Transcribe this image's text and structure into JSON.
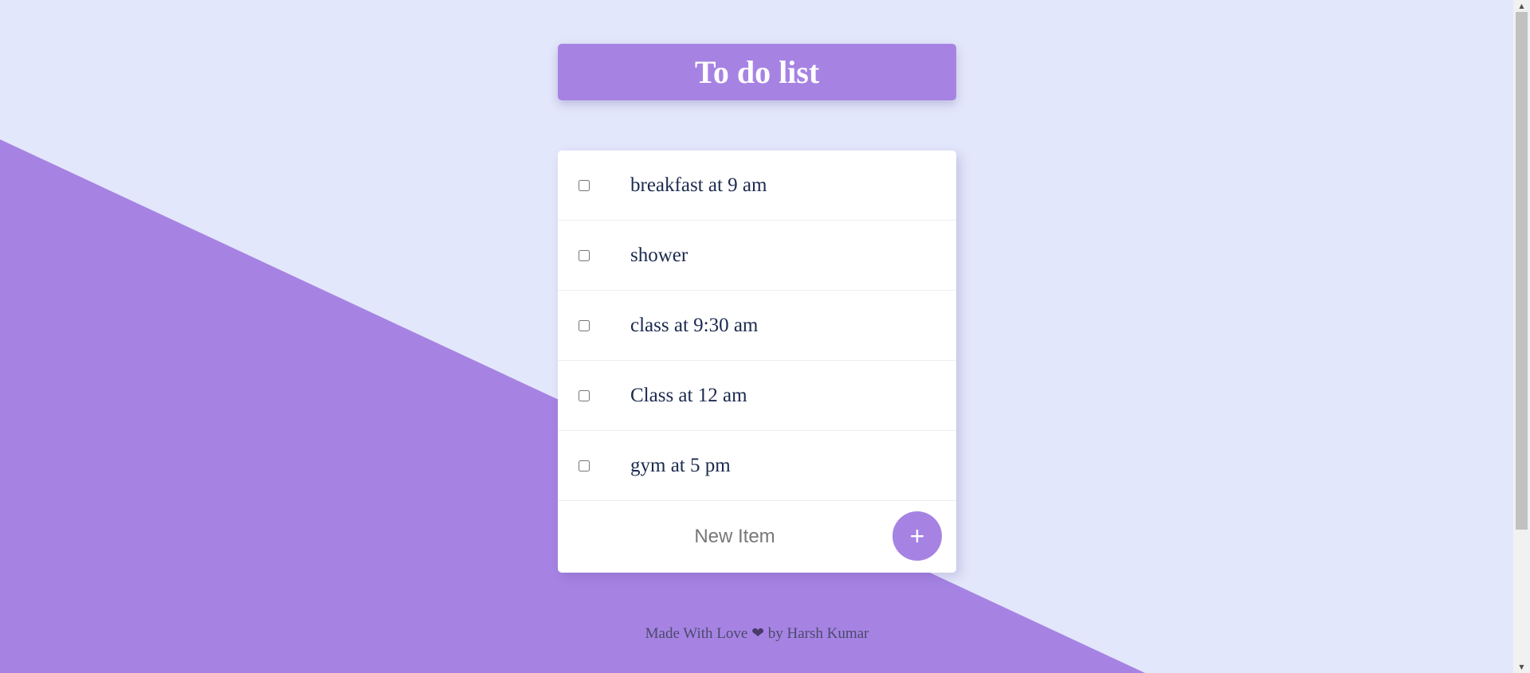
{
  "header": {
    "title": "To do list"
  },
  "items": [
    {
      "label": "breakfast at 9 am",
      "checked": false
    },
    {
      "label": "shower",
      "checked": false
    },
    {
      "label": "class at 9:30 am",
      "checked": false
    },
    {
      "label": "Class at 12 am",
      "checked": false
    },
    {
      "label": "gym at 5 pm",
      "checked": false
    }
  ],
  "new_item": {
    "placeholder": "New Item",
    "value": "",
    "add_label": "+"
  },
  "footer": {
    "text_before": "Made With Love",
    "heart": "❤",
    "text_after": "by Harsh Kumar"
  },
  "colors": {
    "background": "#e3e7fb",
    "accent": "#a683e3",
    "text": "#1b2a4e"
  }
}
